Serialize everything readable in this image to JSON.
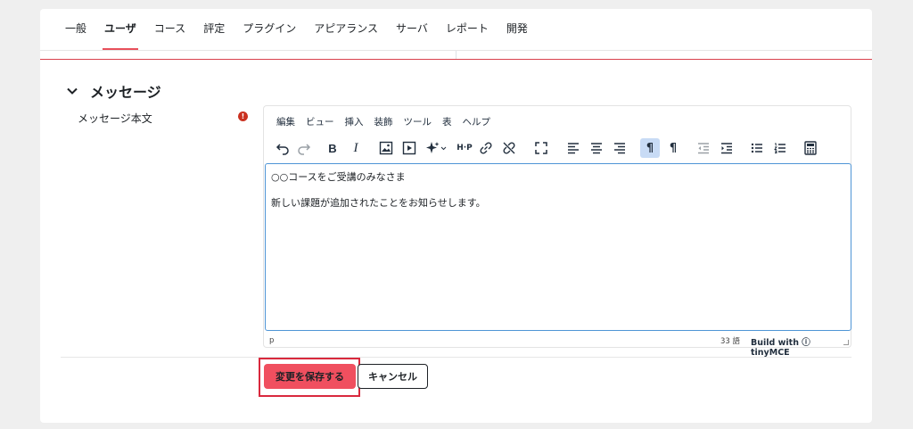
{
  "tabs": [
    {
      "label": "一般"
    },
    {
      "label": "ユーザ"
    },
    {
      "label": "コース"
    },
    {
      "label": "評定"
    },
    {
      "label": "プラグイン"
    },
    {
      "label": "アピアランス"
    },
    {
      "label": "サーバ"
    },
    {
      "label": "レポート"
    },
    {
      "label": "開発"
    }
  ],
  "active_tab": "ユーザ",
  "section": {
    "title": "メッセージ"
  },
  "field": {
    "label": "メッセージ本文",
    "required_icon": "!"
  },
  "editor": {
    "menu": [
      "編集",
      "ビュー",
      "挿入",
      "装飾",
      "ツール",
      "表",
      "ヘルプ"
    ],
    "toolbar_icons": [
      "undo-icon",
      "redo-icon",
      "bold-icon",
      "italic-icon",
      "image-icon",
      "media-icon",
      "ai-sparkle-icon",
      "h5p-icon",
      "link-icon",
      "unlink-icon",
      "fullscreen-icon",
      "align-left-icon",
      "align-center-icon",
      "align-right-icon",
      "ltr-icon",
      "rtl-icon",
      "outdent-icon",
      "indent-icon",
      "bullet-list-icon",
      "numbered-list-icon",
      "calculator-icon"
    ],
    "toolbar_glyphs": {
      "bold": "B",
      "italic": "I",
      "h5p": "H·P",
      "ltr": "¶",
      "rtl": "¶"
    },
    "content": [
      "○○コースをご受講のみなさま",
      "新しい課題が追加されたことをお知らせします。"
    ],
    "status_path": "p",
    "word_count": "33 語",
    "branding": "Build with ⓘ tinyMCE"
  },
  "buttons": {
    "save": "変更を保存する",
    "cancel": "キャンセル"
  },
  "colors": {
    "accent": "#e8505b",
    "save_bg": "#f04f5f",
    "highlight_border": "#d9293d",
    "editor_focus": "#4f95d6"
  }
}
